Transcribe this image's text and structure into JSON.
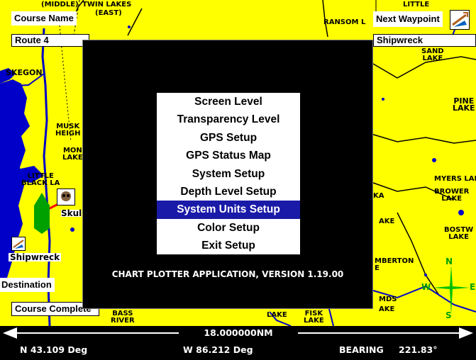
{
  "colors": {
    "land": "#ffff00",
    "water": "#0000c8",
    "road": "#000000",
    "dialog_bg": "#000000",
    "menu_bg": "#ffffff",
    "selection": "#1a1aa8",
    "route": "#ff0000",
    "vessel": "#00a000",
    "compass": "#00c000"
  },
  "header": {
    "course_name_label": "Course Name",
    "course_name_value": "Route 4",
    "next_waypoint_label": "Next Waypoint",
    "next_waypoint_value": "Shipwreck",
    "waypoint_icon": "shipwreck-icon"
  },
  "left_panel": {
    "destination_label": "Destination",
    "course_complete_label": "Course Complete"
  },
  "map_labels": {
    "twin_lakes": "TWIN LAKES",
    "east": "(EAST)",
    "middle": "(MIDDLE)",
    "ransom_lake": "RANSOM L",
    "sand_lake": "SAND\nLAKE",
    "muskegon": "SKEGON",
    "muskegon_heights": "MUSK\nHEIGH",
    "mona_lake": "MON\nLAKE",
    "little_black_lake": "LITTLE\nBLACK LA",
    "skull": "Skul",
    "shipwreck_map": "Shipwreck",
    "pine_lake": "PINE\nLAKE",
    "myers_lake": "MYERS LAKE",
    "brower_lake": "BROWER\nLAKE",
    "ka": "KA",
    "lake_right": "AKE",
    "bostwick_lake": "BOSTW\nLAKE",
    "pemberton": "MBERTON\nE",
    "bass_river": "BASS\nRIVER",
    "fisk_lake": "FISK\nLAKE",
    "lake_bottom": "LAKE",
    "lake_mid": "AKE",
    "little": "LITTLE",
    "mds": "MDS",
    "lake_top_right": "LAKE",
    "compass_n": "N",
    "compass_s": "S",
    "compass_w": "W",
    "compass_e": "E"
  },
  "dialog": {
    "menu_items": [
      "Screen Level",
      "Transparency Level",
      "GPS Setup",
      "GPS Status Map",
      "System Setup",
      "Depth Level Setup",
      "System Units Setup",
      "Color Setup",
      "Exit Setup"
    ],
    "selected_item": "System Units Setup",
    "version_text": "CHART PLOTTER APPLICATION, VERSION 1.19.00"
  },
  "scale_bar": {
    "distance": "18.000000NM"
  },
  "status": {
    "latitude": "N  43.109 Deg",
    "longitude": "W  86.212 Deg",
    "bearing_label": "BEARING",
    "bearing_value": "221.83°"
  }
}
